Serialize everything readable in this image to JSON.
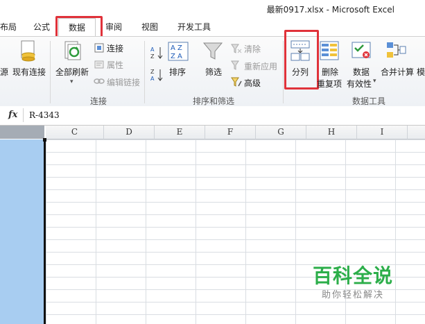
{
  "window": {
    "title": "最新0917.xlsx - Microsoft Excel"
  },
  "tabs": [
    {
      "label": "布局"
    },
    {
      "label": "公式"
    },
    {
      "label": "数据",
      "active": true
    },
    {
      "label": "审阅"
    },
    {
      "label": "视图"
    },
    {
      "label": "开发工具"
    }
  ],
  "ribbon": {
    "get_external": {
      "partial_label": "源",
      "existing_connections": "现有连接"
    },
    "connections": {
      "refresh_all": "全部刷新",
      "connections": "连接",
      "properties": "属性",
      "edit_links": "编辑链接",
      "group_label": "连接"
    },
    "sort_filter": {
      "sort": "排序",
      "filter": "筛选",
      "clear": "清除",
      "reapply": "重新应用",
      "advanced": "高级",
      "group_label": "排序和筛选"
    },
    "data_tools": {
      "text_to_columns": "分列",
      "remove_dup_line1": "删除",
      "remove_dup_line2": "重复项",
      "validation_line1": "数据",
      "validation_line2": "有效性",
      "consolidate": "合并计算",
      "what_if_partial": "模",
      "group_label": "数据工具"
    }
  },
  "formula_bar": {
    "fx": "fx",
    "value": "R-4343"
  },
  "columns": [
    "C",
    "D",
    "E",
    "F",
    "G",
    "H",
    "I"
  ],
  "watermark": {
    "title": "百科全说",
    "subtitle": "助你轻松解决"
  },
  "colors": {
    "highlight": "#e0323a",
    "selection": "#a8cdf1",
    "watermark": "#2cae4a"
  }
}
